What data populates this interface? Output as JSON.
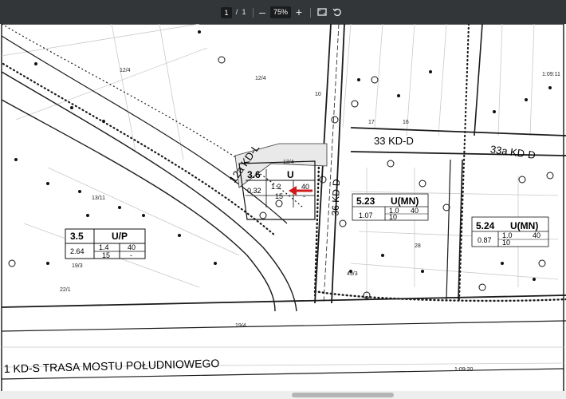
{
  "toolbar": {
    "current_page": "1",
    "page_sep": "/",
    "total_pages": "1",
    "zoom_out": "–",
    "zoom": "75%",
    "zoom_in": "+"
  },
  "map": {
    "labels": {
      "zone_36": "3.6",
      "zone_36_use": "U",
      "zone_36_a": "0.32",
      "zone_36_b": "1.2",
      "zone_36_c": "40",
      "zone_36_d": "15",
      "zone_36_e": "-",
      "zone_35": "3.5",
      "zone_35_use": "U/P",
      "zone_35_a": "2.64",
      "zone_35_b": "1.4",
      "zone_35_c": "40",
      "zone_35_d": "15",
      "zone_35_e": "-",
      "zone_523": "5.23",
      "zone_523_use": "U(MN)",
      "zone_523_a": "1.07",
      "zone_523_b": "1.0",
      "zone_523_c": "40",
      "zone_523_d": "10",
      "zone_524": "5.24",
      "zone_524_use": "U(MN)",
      "zone_524_a": "0.87",
      "zone_524_b": "1.0",
      "zone_524_c": "40",
      "zone_524_d": "10",
      "road_12a": "12a KD-L",
      "road_33": "33 KD-D",
      "road_33a": "33a KD-D",
      "road_kds": "1 KD-S  TRASA MOSTU POŁUDNIOWEGO",
      "road_vertical": "36 KD-D",
      "parcel_1": "12/4",
      "parcel_2": "13/11",
      "parcel_3": "19/3",
      "parcel_4": "22/1",
      "parcel_5": "13/4",
      "parcel_6": "17",
      "parcel_7": "16",
      "parcel_8": "10",
      "parcel_9": "49/3",
      "parcel_10": "28",
      "parcel_11": "12/4",
      "parcel_12": "19/4",
      "parcel_13": "1:09:20",
      "parcel_14": "1:09:11"
    }
  }
}
